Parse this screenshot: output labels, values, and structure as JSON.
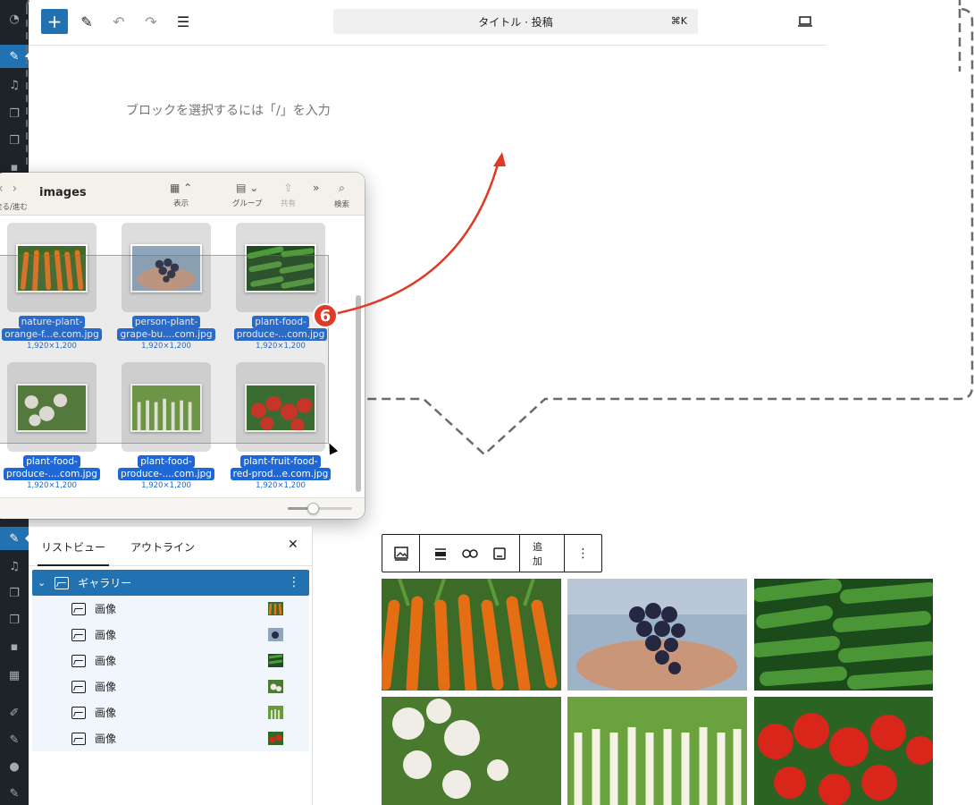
{
  "editor": {
    "command_bar_label": "タイトル · 投稿",
    "command_bar_shortcut": "⌘K",
    "empty_block_placeholder": "ブロックを選択するには「/」を入力"
  },
  "finder": {
    "title": "images",
    "nav_label": "戻る/進む",
    "toolbar": {
      "view_label": "表示",
      "group_label": "グループ",
      "share_label": "共有",
      "search_label": "検索"
    },
    "files": [
      {
        "name_line1": "nature-plant-",
        "name_line2": "orange-f...e.com.jpg",
        "dims": "1,920×1,200",
        "image": "carrots"
      },
      {
        "name_line1": "person-plant-",
        "name_line2": "grape-bu....com.jpg",
        "dims": "1,920×1,200",
        "image": "grapes"
      },
      {
        "name_line1": "plant-food-",
        "name_line2": "produce-...com.jpg",
        "dims": "1,920×1,200",
        "image": "cucumbers"
      },
      {
        "name_line1": "plant-food-",
        "name_line2": "produce-....com.jpg",
        "dims": "1,920×1,200",
        "image": "turnips"
      },
      {
        "name_line1": "plant-food-",
        "name_line2": "produce-....com.jpg",
        "dims": "1,920×1,200",
        "image": "scallions"
      },
      {
        "name_line1": "plant-fruit-food-",
        "name_line2": "red-prod...e.com.jpg",
        "dims": "1,920×1,200",
        "image": "tomatoes"
      }
    ]
  },
  "annotation": {
    "step_number": "6",
    "color": "#e03a27"
  },
  "list_view": {
    "tab_list": "リストビュー",
    "tab_outline": "アウトライン",
    "close_glyph": "✕",
    "gallery_label": "ギャラリー",
    "children": [
      {
        "label": "画像",
        "image": "carrots"
      },
      {
        "label": "画像",
        "image": "grapes"
      },
      {
        "label": "画像",
        "image": "cucumbers"
      },
      {
        "label": "画像",
        "image": "turnips"
      },
      {
        "label": "画像",
        "image": "scallions"
      },
      {
        "label": "画像",
        "image": "tomatoes"
      }
    ]
  },
  "block_toolbar": {
    "add_label": "追加"
  },
  "colors": {
    "wp_blue": "#2271b1",
    "admin_dark": "#1d2327",
    "finder_select": "#1d68d6"
  }
}
